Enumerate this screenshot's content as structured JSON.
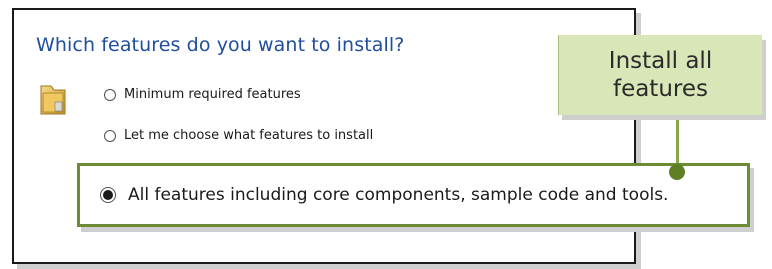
{
  "dialog": {
    "heading": "Which features do you want to install?",
    "options": [
      {
        "label": "Minimum required features",
        "selected": false
      },
      {
        "label": "Let me choose what features to install",
        "selected": false
      },
      {
        "label": "All features including core components, sample code and tools.",
        "selected": true
      }
    ],
    "icon": "folder-icon"
  },
  "callout": {
    "line1": "Install all",
    "line2": "features"
  },
  "colors": {
    "heading": "#1f4e9c",
    "callout_bg": "#d8e6b8",
    "highlight_border": "#6d8a34",
    "connector": "#8aa54a"
  }
}
